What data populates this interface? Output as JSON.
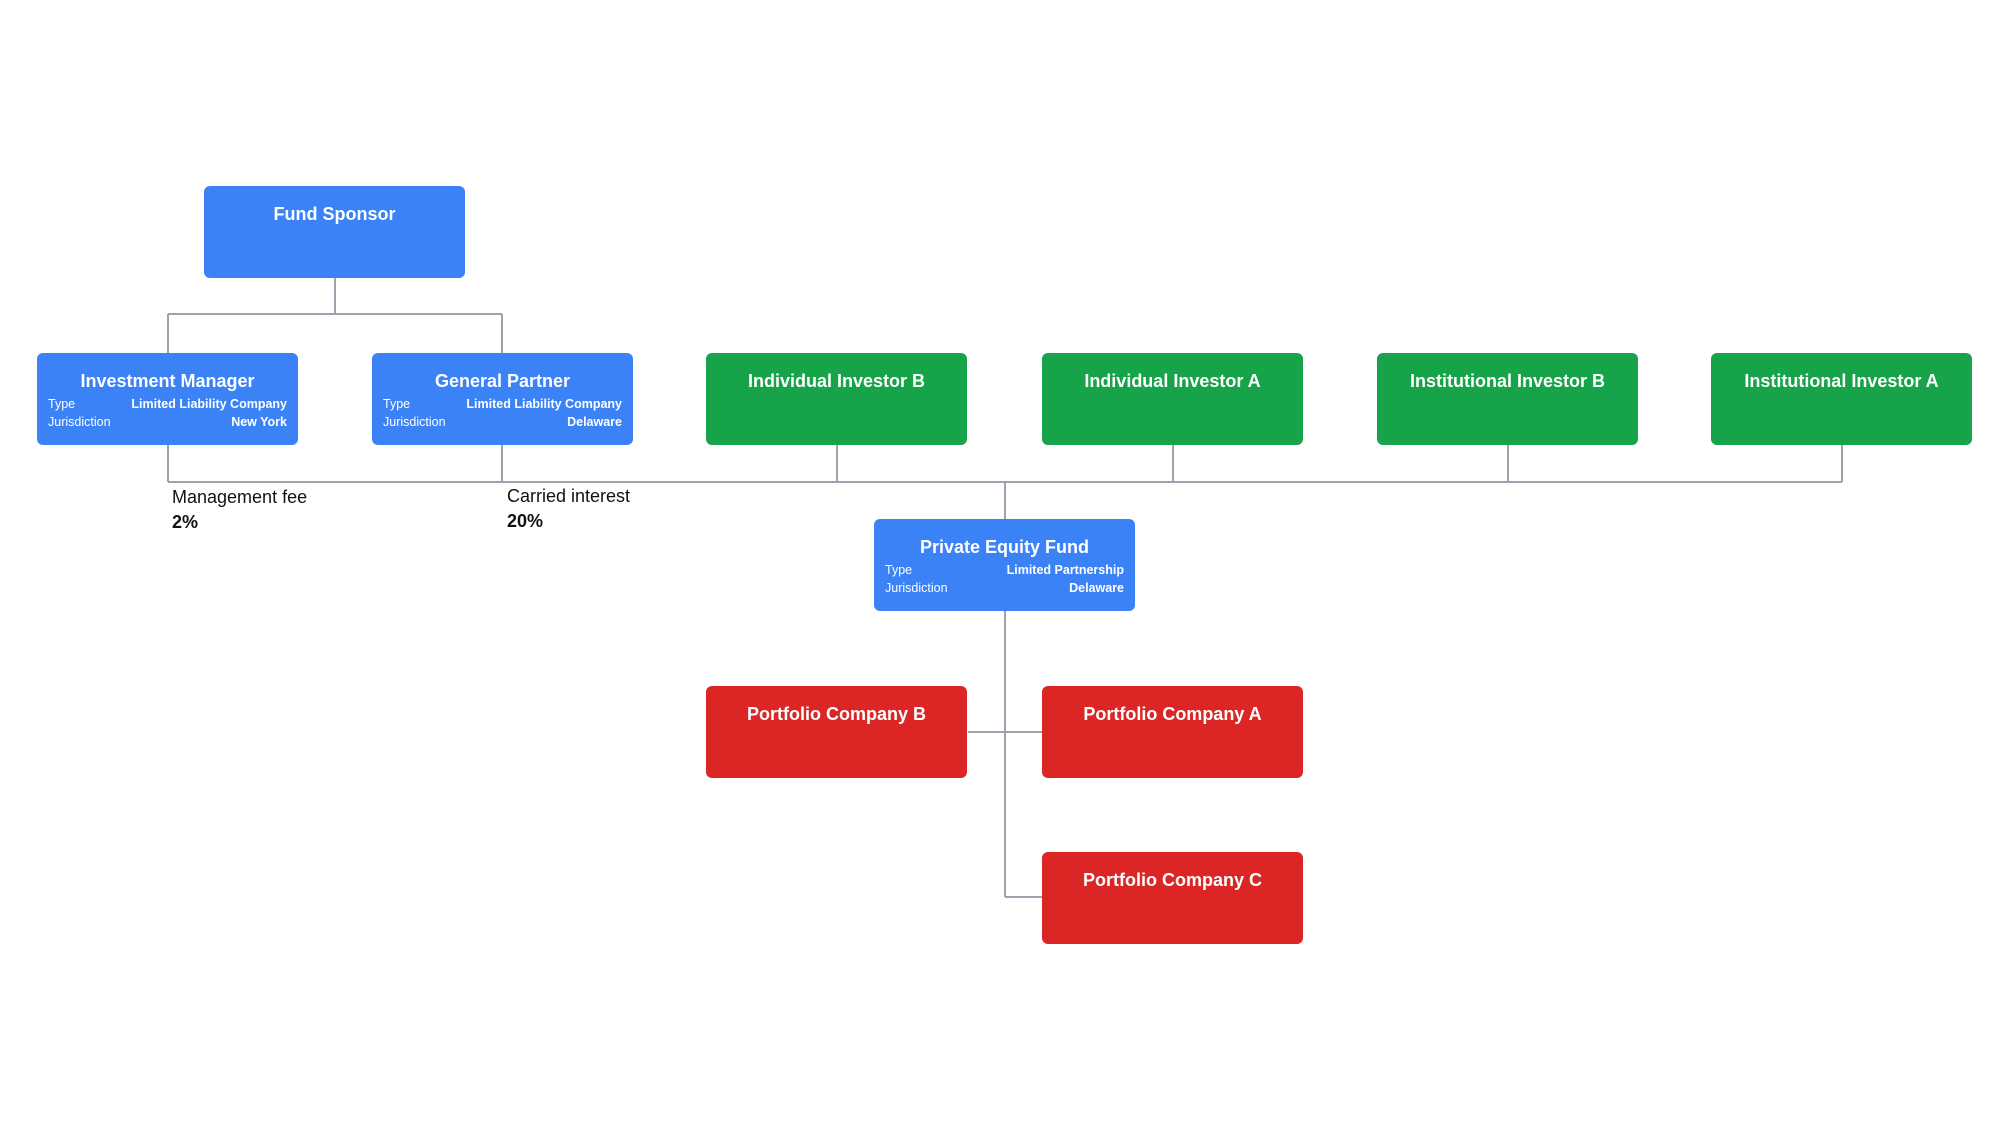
{
  "colors": {
    "sponsor_side": "#3b82f6",
    "investor": "#16a34a",
    "portfolio": "#dc2626",
    "connector": "#9ca3af"
  },
  "nodes": {
    "fund_sponsor": {
      "title": "Fund Sponsor"
    },
    "investment_manager": {
      "title": "Investment Manager",
      "details": [
        {
          "label": "Type",
          "value": "Limited Liability Company"
        },
        {
          "label": "Jurisdiction",
          "value": "New York"
        }
      ]
    },
    "general_partner": {
      "title": "General Partner",
      "details": [
        {
          "label": "Type",
          "value": "Limited Liability Company"
        },
        {
          "label": "Jurisdiction",
          "value": "Delaware"
        }
      ]
    },
    "individual_investor_b": {
      "title": "Individual Investor B"
    },
    "individual_investor_a": {
      "title": "Individual Investor A"
    },
    "institutional_investor_b": {
      "title": "Institutional Investor B"
    },
    "institutional_investor_a": {
      "title": "Institutional Investor A"
    },
    "private_equity_fund": {
      "title": "Private Equity Fund",
      "details": [
        {
          "label": "Type",
          "value": "Limited Partnership"
        },
        {
          "label": "Jurisdiction",
          "value": "Delaware"
        }
      ]
    },
    "portfolio_company_b": {
      "title": "Portfolio Company B"
    },
    "portfolio_company_a": {
      "title": "Portfolio Company A"
    },
    "portfolio_company_c": {
      "title": "Portfolio Company C"
    }
  },
  "edge_labels": {
    "management_fee": {
      "label": "Management fee",
      "value": "2%"
    },
    "carried_interest": {
      "label": "Carried interest",
      "value": "20%"
    }
  }
}
